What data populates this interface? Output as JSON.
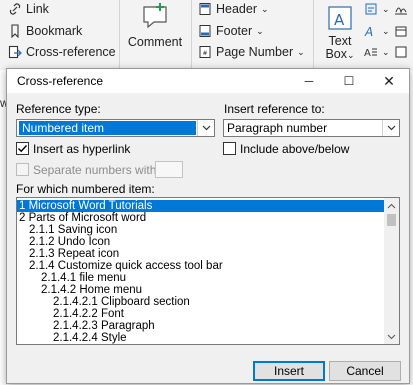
{
  "ribbon": {
    "link": "Link",
    "bookmark": "Bookmark",
    "cross_reference": "Cross-reference",
    "comment": "Comment",
    "header": "Header",
    "footer": "Footer",
    "page_number": "Page Number",
    "text_box_line1": "Text",
    "text_box_line2": "Box",
    "text_box_caret": "⌄",
    "edge_char": "w"
  },
  "dialog": {
    "title": "Cross-reference",
    "minimize": "─",
    "maximize": "☐",
    "close": "✕",
    "reference_type_label": "Reference type:",
    "reference_type_value": "Numbered item",
    "insert_reference_to_label": "Insert reference to:",
    "insert_reference_to_value": "Paragraph number",
    "insert_as_hyperlink": {
      "label": "Insert as hyperlink",
      "checked": true
    },
    "include_above_below": {
      "label": "Include above/below",
      "checked": false
    },
    "separate_numbers": {
      "label": "Separate numbers with",
      "checked": false,
      "enabled": false
    },
    "for_which_label": "For which numbered item:",
    "items": [
      "1 Microsoft Word Tutorials",
      "2 Parts of Microsoft word",
      "2.1.1 Saving icon",
      "2.1.2 Undo Icon",
      "2.1.3 Repeat icon",
      "2.1.4 Customize quick access tool bar",
      "2.1.4.1 file menu",
      "2.1.4.2 Home menu",
      "2.1.4.2.1 Clipboard section",
      "2.1.4.2.2 Font",
      "2.1.4.2.3 Paragraph",
      "2.1.4.2.4 Style"
    ],
    "selected_index": 0,
    "insert_button": "Insert",
    "cancel_button": "Cancel"
  },
  "colors": {
    "accent": "#0078d7",
    "dialog_bg": "#f0f0f0",
    "ribbon_bg": "#f3f3f3"
  }
}
